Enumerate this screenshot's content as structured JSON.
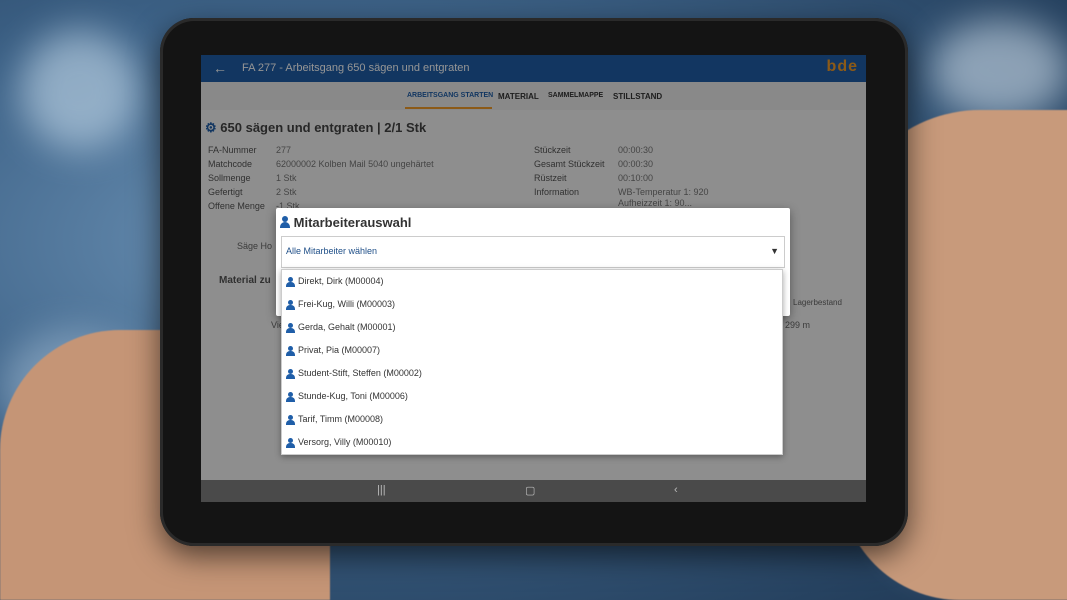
{
  "app": {
    "title": "FA 277 - Arbeitsgang 650 sägen und entgraten",
    "brand": "bde"
  },
  "tabs": [
    {
      "label": "ARBEITSGANG STARTEN",
      "active": true
    },
    {
      "label": "MATERIAL",
      "active": false
    },
    {
      "label": "SAMMELMAPPE",
      "active": false
    },
    {
      "label": "STILLSTAND",
      "active": false
    }
  ],
  "operation": {
    "title": "650 sägen und entgraten | 2/1 Stk",
    "left_fields": [
      {
        "label": "FA-Nummer",
        "value": "277"
      },
      {
        "label": "Matchcode",
        "value": "62000002 Kolben Mail 5040 ungehärtet"
      },
      {
        "label": "Sollmenge",
        "value": "1 Stk"
      },
      {
        "label": "Gefertigt",
        "value": "2 Stk"
      },
      {
        "label": "Offene Menge",
        "value": "-1 Stk"
      }
    ],
    "right_fields": [
      {
        "label": "Stückzeit",
        "value": "00:00:30"
      },
      {
        "label": "Gesamt Stückzeit",
        "value": "00:00:30"
      },
      {
        "label": "Rüstzeit",
        "value": "00:10:00"
      },
      {
        "label": "Information",
        "value": "WB-Temperatur 1: 920"
      },
      {
        "label": "",
        "value": "Aufheizzeit 1: 90..."
      }
    ],
    "partial": {
      "machine": "Säge Ho",
      "material": "Material zu",
      "col_header": "Lagerbestand",
      "stock": "299 m",
      "left_cell": "Vie"
    }
  },
  "dialog": {
    "title": "Mitarbeiterauswahl",
    "select_value": "Alle Mitarbeiter wählen",
    "options": [
      "Direkt, Dirk (M00004)",
      "Frei-Kug, Willi (M00003)",
      "Gerda, Gehalt (M00001)",
      "Privat, Pia (M00007)",
      "Student-Stift, Steffen (M00002)",
      "Stunde-Kug, Toni (M00006)",
      "Tarif, Timm (M00008)",
      "Versorg, Villy (M00010)"
    ]
  },
  "colors": {
    "appbar": "#1f5ea8",
    "accent": "#f29b28"
  },
  "icons": [
    "back-arrow-icon",
    "user-icon",
    "caret-down-icon",
    "recents-icon",
    "home-icon",
    "back-icon"
  ]
}
